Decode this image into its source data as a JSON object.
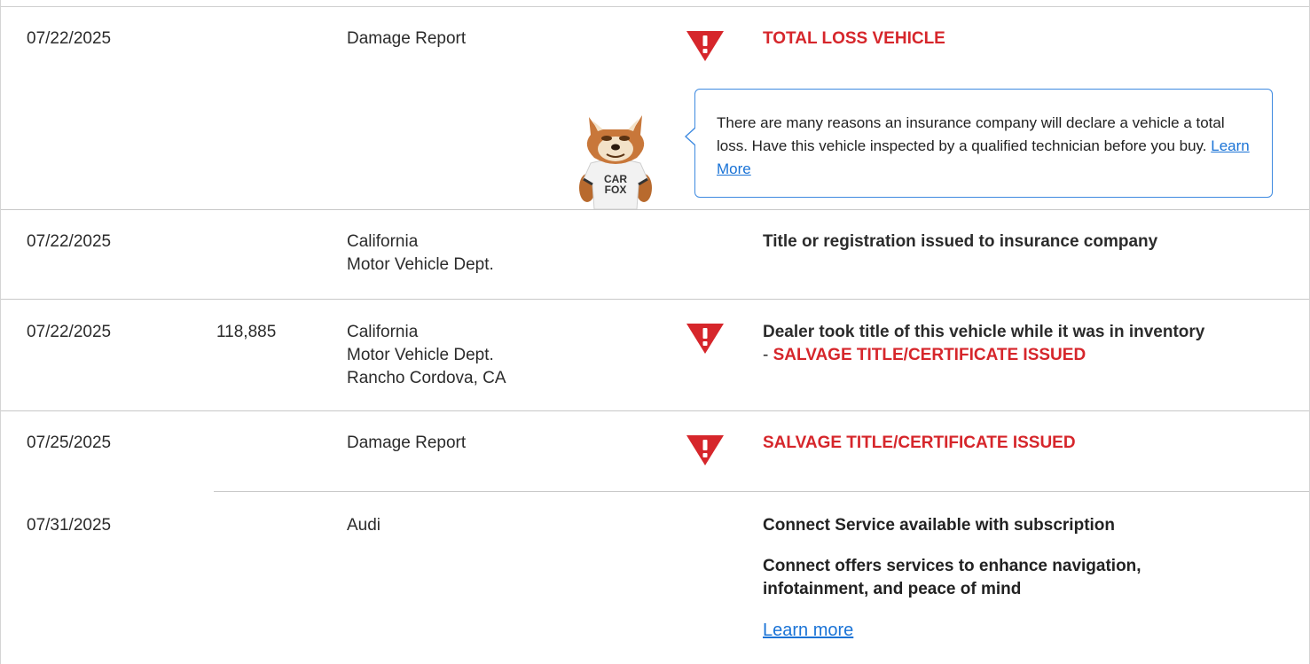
{
  "colors": {
    "alert_red": "#d6262b",
    "link_blue": "#1a73d6",
    "tooltip_border": "#3e8ae0",
    "divider": "#c8c8c8"
  },
  "rows": [
    {
      "date": "07/22/2025",
      "odometer": "",
      "source": [
        "Damage Report"
      ],
      "alert": true,
      "comment": "TOTAL LOSS VEHICLE",
      "tooltip": {
        "text": "There are many reasons an insurance company will declare a vehicle a total loss. Have this vehicle inspected by a qualified technician before you buy.",
        "link": "Learn More"
      },
      "mascot": {
        "shirt_line1": "CAR",
        "shirt_line2": "FOX"
      }
    },
    {
      "date": "07/22/2025",
      "odometer": "",
      "source": [
        "California",
        "Motor Vehicle Dept."
      ],
      "alert": false,
      "comment": "Title or registration issued to insurance company"
    },
    {
      "date": "07/22/2025",
      "odometer": "118,885",
      "source": [
        "California",
        "Motor Vehicle Dept.",
        "Rancho Cordova, CA"
      ],
      "alert": true,
      "comment": "Dealer took title of this vehicle while it was in inventory",
      "comment_prefix": "- ",
      "comment_red": "SALVAGE TITLE/CERTIFICATE ISSUED"
    },
    {
      "date": "07/25/2025",
      "odometer": "",
      "source": [
        "Damage Report"
      ],
      "alert": true,
      "comment": "SALVAGE TITLE/CERTIFICATE ISSUED"
    },
    {
      "date": "07/31/2025",
      "odometer": "",
      "source": [
        "Audi"
      ],
      "alert": false,
      "comment": "Connect Service available with subscription",
      "comment_detail_1": "Connect offers services to enhance navigation,",
      "comment_detail_2": "infotainment, and peace of mind",
      "link": "Learn more"
    }
  ]
}
